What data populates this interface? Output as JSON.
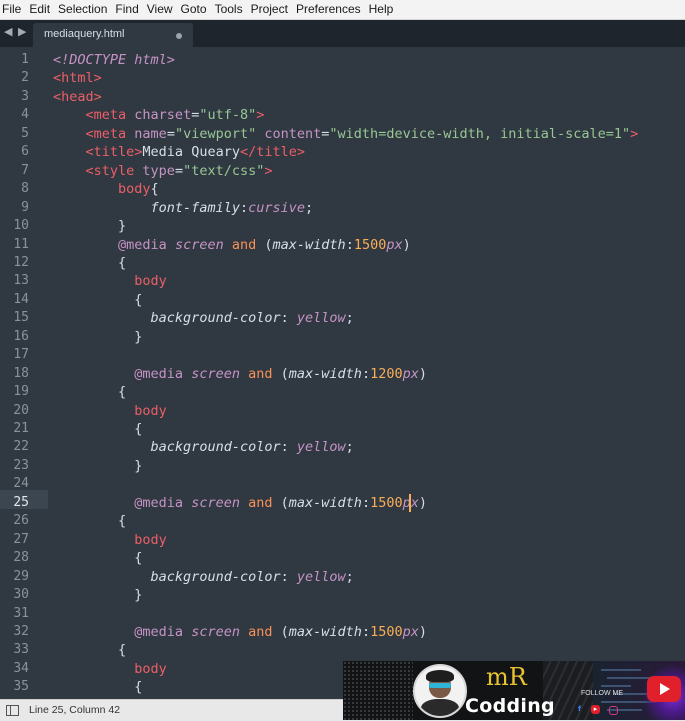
{
  "menu": [
    "File",
    "Edit",
    "Selection",
    "Find",
    "View",
    "Goto",
    "Tools",
    "Project",
    "Preferences",
    "Help"
  ],
  "tab": {
    "title": "mediaquery.html",
    "nav": "◀ ▶"
  },
  "editor": {
    "active_line": 25,
    "lines": [
      [
        [
          "t-doc",
          "<!DOCTYPE html>"
        ]
      ],
      [
        [
          "t-tag",
          "<html>"
        ]
      ],
      [
        [
          "t-tag",
          "<head>"
        ]
      ],
      [
        [
          "t-text",
          "    "
        ],
        [
          "t-tag",
          "<meta "
        ],
        [
          "t-attr",
          "charset"
        ],
        [
          "t-text",
          "="
        ],
        [
          "t-str",
          "\"utf-8\""
        ],
        [
          "t-tag",
          ">"
        ]
      ],
      [
        [
          "t-text",
          "    "
        ],
        [
          "t-tag",
          "<meta "
        ],
        [
          "t-attr",
          "name"
        ],
        [
          "t-text",
          "="
        ],
        [
          "t-str",
          "\"viewport\""
        ],
        [
          "t-text",
          " "
        ],
        [
          "t-attr",
          "content"
        ],
        [
          "t-text",
          "="
        ],
        [
          "t-str",
          "\"width=device-width, initial-scale=1\""
        ],
        [
          "t-tag",
          ">"
        ]
      ],
      [
        [
          "t-text",
          "    "
        ],
        [
          "t-tag",
          "<title>"
        ],
        [
          "t-text",
          "Media Queary"
        ],
        [
          "t-tag",
          "</title>"
        ]
      ],
      [
        [
          "t-text",
          "    "
        ],
        [
          "t-tag",
          "<style "
        ],
        [
          "t-attr",
          "type"
        ],
        [
          "t-text",
          "="
        ],
        [
          "t-str",
          "\"text/css\""
        ],
        [
          "t-tag",
          ">"
        ]
      ],
      [
        [
          "t-text",
          "        "
        ],
        [
          "t-tag",
          "body"
        ],
        [
          "t-text",
          "{"
        ]
      ],
      [
        [
          "t-text",
          "            "
        ],
        [
          "t-prop",
          "font-family"
        ],
        [
          "t-text",
          ":"
        ],
        [
          "t-val",
          "cursive"
        ],
        [
          "t-text",
          ";"
        ]
      ],
      [
        [
          "t-text",
          "        }"
        ]
      ],
      [
        [
          "t-text",
          "        "
        ],
        [
          "t-at",
          "@media"
        ],
        [
          "t-text",
          " "
        ],
        [
          "t-kw",
          "screen"
        ],
        [
          "t-text",
          " "
        ],
        [
          "t-and",
          "and"
        ],
        [
          "t-text",
          " ("
        ],
        [
          "t-prop",
          "max-width"
        ],
        [
          "t-text",
          ":"
        ],
        [
          "t-num",
          "1500"
        ],
        [
          "t-unit",
          "px"
        ],
        [
          "t-text",
          ")"
        ]
      ],
      [
        [
          "t-text",
          "        {"
        ]
      ],
      [
        [
          "t-text",
          "          "
        ],
        [
          "t-tag",
          "body"
        ]
      ],
      [
        [
          "t-text",
          "          {"
        ]
      ],
      [
        [
          "t-text",
          "            "
        ],
        [
          "t-prop",
          "background-color"
        ],
        [
          "t-text",
          ": "
        ],
        [
          "t-val",
          "yellow"
        ],
        [
          "t-text",
          ";"
        ]
      ],
      [
        [
          "t-text",
          "          }"
        ]
      ],
      [],
      [
        [
          "t-text",
          "          "
        ],
        [
          "t-at",
          "@media"
        ],
        [
          "t-text",
          " "
        ],
        [
          "t-kw",
          "screen"
        ],
        [
          "t-text",
          " "
        ],
        [
          "t-and",
          "and"
        ],
        [
          "t-text",
          " ("
        ],
        [
          "t-prop",
          "max-width"
        ],
        [
          "t-text",
          ":"
        ],
        [
          "t-num",
          "1200"
        ],
        [
          "t-unit",
          "px"
        ],
        [
          "t-text",
          ")"
        ]
      ],
      [
        [
          "t-text",
          "        {"
        ]
      ],
      [
        [
          "t-text",
          "          "
        ],
        [
          "t-tag",
          "body"
        ]
      ],
      [
        [
          "t-text",
          "          {"
        ]
      ],
      [
        [
          "t-text",
          "            "
        ],
        [
          "t-prop",
          "background-color"
        ],
        [
          "t-text",
          ": "
        ],
        [
          "t-val",
          "yellow"
        ],
        [
          "t-text",
          ";"
        ]
      ],
      [
        [
          "t-text",
          "          }"
        ]
      ],
      [],
      [
        [
          "t-text",
          "          "
        ],
        [
          "t-at",
          "@media"
        ],
        [
          "t-text",
          " "
        ],
        [
          "t-kw",
          "screen"
        ],
        [
          "t-text",
          " "
        ],
        [
          "t-and",
          "and"
        ],
        [
          "t-text",
          " ("
        ],
        [
          "t-prop",
          "max-width"
        ],
        [
          "t-text",
          ":"
        ],
        [
          "t-num",
          "1500"
        ],
        [
          "t-unit",
          "px"
        ],
        [
          "t-text",
          ")"
        ]
      ],
      [
        [
          "t-text",
          "        {"
        ]
      ],
      [
        [
          "t-text",
          "          "
        ],
        [
          "t-tag",
          "body"
        ]
      ],
      [
        [
          "t-text",
          "          {"
        ]
      ],
      [
        [
          "t-text",
          "            "
        ],
        [
          "t-prop",
          "background-color"
        ],
        [
          "t-text",
          ": "
        ],
        [
          "t-val",
          "yellow"
        ],
        [
          "t-text",
          ";"
        ]
      ],
      [
        [
          "t-text",
          "          }"
        ]
      ],
      [],
      [
        [
          "t-text",
          "          "
        ],
        [
          "t-at",
          "@media"
        ],
        [
          "t-text",
          " "
        ],
        [
          "t-kw",
          "screen"
        ],
        [
          "t-text",
          " "
        ],
        [
          "t-and",
          "and"
        ],
        [
          "t-text",
          " ("
        ],
        [
          "t-prop",
          "max-width"
        ],
        [
          "t-text",
          ":"
        ],
        [
          "t-num",
          "1500"
        ],
        [
          "t-unit",
          "px"
        ],
        [
          "t-text",
          ")"
        ]
      ],
      [
        [
          "t-text",
          "        {"
        ]
      ],
      [
        [
          "t-text",
          "          "
        ],
        [
          "t-tag",
          "body"
        ]
      ],
      [
        [
          "t-text",
          "          {"
        ]
      ]
    ]
  },
  "status": {
    "position": "Line 25, Column 42"
  },
  "banner": {
    "mark": "mR",
    "name": "Codding",
    "follow": "FOLLOW ME",
    "social": [
      "facebook-icon",
      "youtube-icon",
      "instagram-icon"
    ]
  },
  "colors": {
    "editor_bg": "#303841",
    "tag": "#ec5f67",
    "attribute": "#c594c5",
    "string": "#99c794",
    "keyword_and": "#f99157",
    "number": "#f9ae58",
    "caret": "#f9ae58"
  }
}
